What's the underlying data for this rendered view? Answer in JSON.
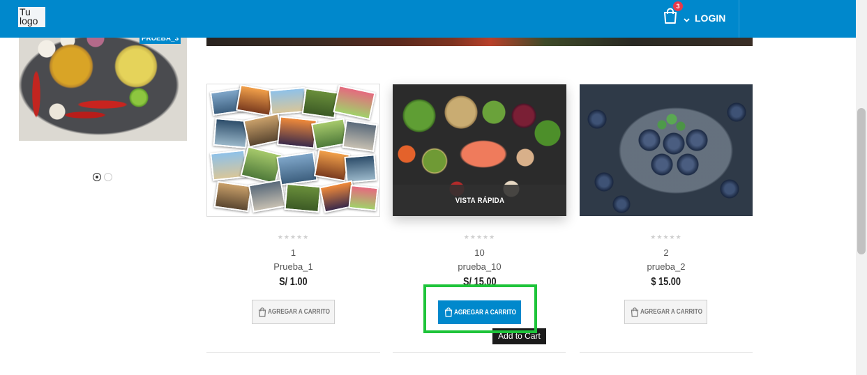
{
  "header": {
    "logo_line1": "Tu",
    "logo_line2": "logo",
    "cart_icon": "shopping-bag-icon",
    "cart_count": "3",
    "login_label": "LOGIN"
  },
  "sidebar": {
    "badge": "PRUEBA_3",
    "carousel_dots": 2,
    "active_dot": 0
  },
  "quick_view_label": "VISTA RÁPIDA",
  "products": [
    {
      "code": "1",
      "name": "Prueba_1",
      "price": "S/ 1.00",
      "rating": 0,
      "rating_max": 5,
      "button": "AGREGAR A CARRITO"
    },
    {
      "code": "10",
      "name": "prueba_10",
      "price": "S/ 15.00",
      "rating": 0,
      "rating_max": 5,
      "button": "AGREGAR A CARRITO"
    },
    {
      "code": "2",
      "name": "prueba_2",
      "price": "$ 15.00",
      "rating": 0,
      "rating_max": 5,
      "button": "AGREGAR A CARRITO"
    }
  ],
  "tooltip": "Add to Cart",
  "colors": {
    "primary": "#0088cc",
    "cart_badge": "#e8394a",
    "highlight": "#1ec43a",
    "star_empty": "#cfcfcf",
    "star_filled": "#f5b301"
  }
}
